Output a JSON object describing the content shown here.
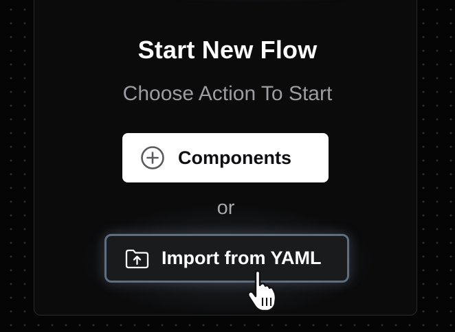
{
  "empty_state": {
    "title": "Start New Flow",
    "subtitle": "Choose Action To Start",
    "separator": "or"
  },
  "actions": {
    "components": {
      "label": "Components",
      "icon": "plus-circle-icon"
    },
    "import_yaml": {
      "label": "Import from YAML",
      "icon": "folder-upload-icon"
    }
  },
  "cursor": {
    "icon": "hand-pointer-icon"
  },
  "colors": {
    "background": "#050505",
    "panel": "#0b0b0c",
    "primary_button": "#ffffff",
    "secondary_button": "#1a1b1d",
    "secondary_button_border": "#5d6f80",
    "muted_text": "#9c9ca1"
  }
}
